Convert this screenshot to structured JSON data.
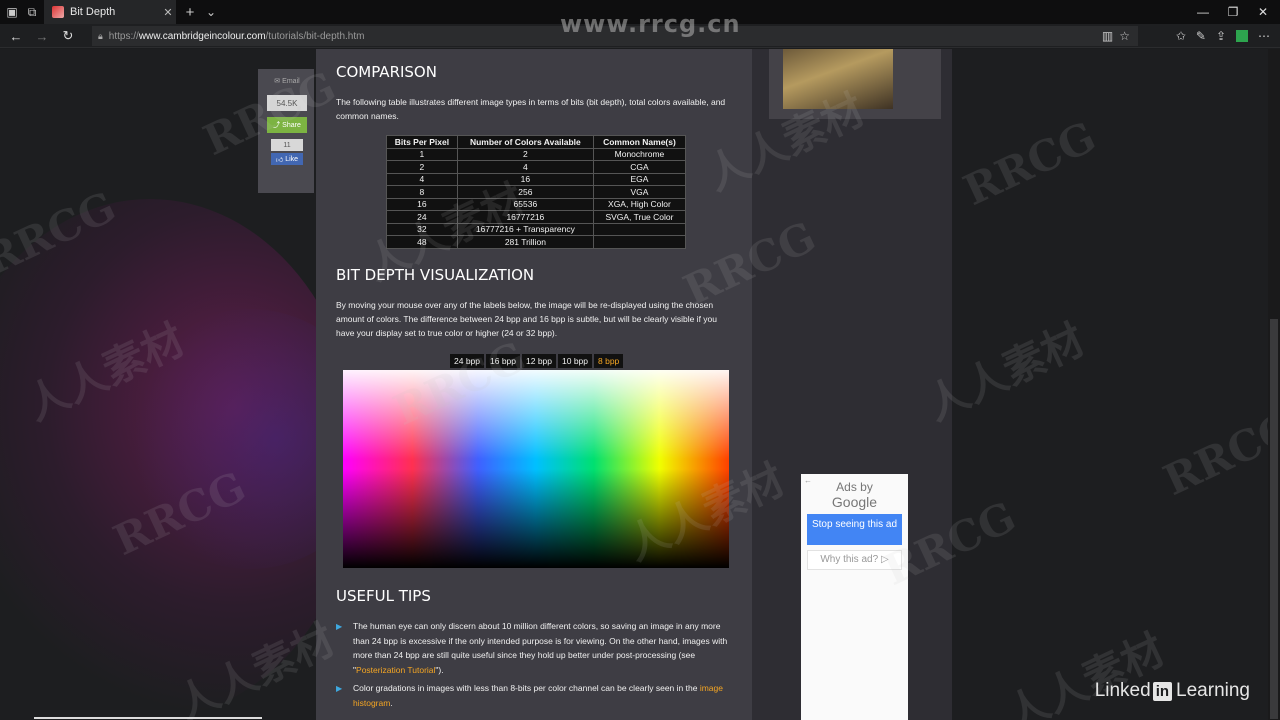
{
  "browser": {
    "tab_title": "Bit Depth",
    "url_scheme": "https://",
    "url_host": "www.cambridgeincolour.com",
    "url_path": "/tutorials/bit-depth.htm"
  },
  "watermark": {
    "top_text": "www.rrcg.cn",
    "rrcg": "RRCG",
    "cn": "人人素材",
    "linkedin_text": "Linked",
    "linkedin_in": "in",
    "linkedin_learning": "Learning"
  },
  "share": {
    "email": "Email",
    "count": "54.5K",
    "share": "Share",
    "like_count": "11",
    "like": "Like"
  },
  "comparison": {
    "title": "COMPARISON",
    "intro": "The following table illustrates different image types in terms of bits (bit depth), total colors available, and common names.",
    "headers": [
      "Bits Per Pixel",
      "Number of Colors Available",
      "Common Name(s)"
    ],
    "rows": [
      [
        "1",
        "2",
        "Monochrome"
      ],
      [
        "2",
        "4",
        "CGA"
      ],
      [
        "4",
        "16",
        "EGA"
      ],
      [
        "8",
        "256",
        "VGA"
      ],
      [
        "16",
        "65536",
        "XGA, High Color"
      ],
      [
        "24",
        "16777216",
        "SVGA, True Color"
      ],
      [
        "32",
        "16777216 + Transparency",
        ""
      ],
      [
        "48",
        "281 Trillion",
        ""
      ]
    ]
  },
  "visualization": {
    "title": "BIT DEPTH VISUALIZATION",
    "intro": "By moving your mouse over any of the labels below, the image will be re-displayed using the chosen amount of colors. The difference between 24 bpp and 16 bpp is subtle, but will be clearly visible if you have your display set to true color or higher (24 or 32 bpp).",
    "tabs": [
      "24 bpp",
      "16 bpp",
      "12 bpp",
      "10 bpp",
      "8 bpp"
    ],
    "active_tab": "8 bpp"
  },
  "tips": {
    "title": "USEFUL TIPS",
    "tip1_a": "The human eye can only discern about 10 million different colors, so saving an image in any more than 24 bpp is excessive if the only intended purpose is for viewing. On the other hand, images with more than 24 bpp are still quite useful since they hold up better under post-processing (see \"",
    "tip1_link": "Posterization Tutorial",
    "tip1_b": "\").",
    "tip2_a": "Color gradations in images with less than 8-bits per color channel can be clearly seen in the ",
    "tip2_link": "image histogram",
    "tip2_b": "."
  },
  "ad": {
    "ads_by": "Ads by",
    "google": "Google",
    "stop": "Stop seeing this ad",
    "why": "Why this ad?"
  }
}
